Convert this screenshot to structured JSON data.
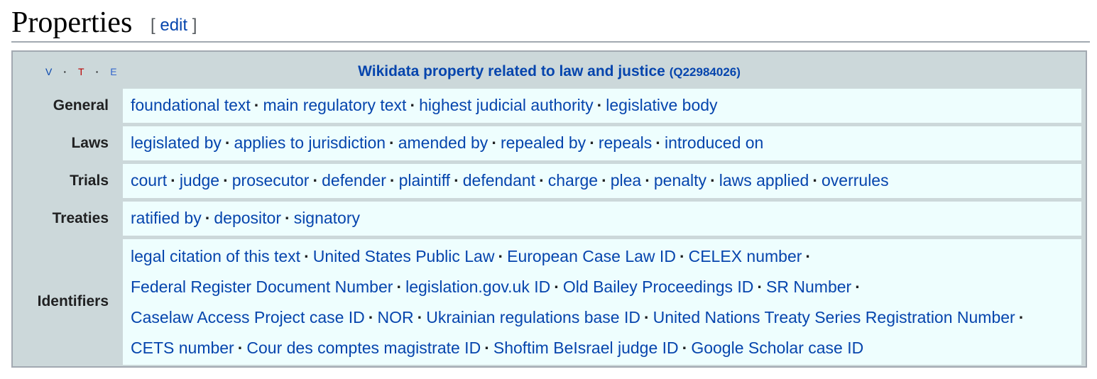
{
  "section": {
    "title": "Properties",
    "edit_open": "[ ",
    "edit_label": "edit",
    "edit_close": " ]"
  },
  "navbox": {
    "vte": {
      "v": "V",
      "t": "T",
      "e": "E",
      "sep": "·"
    },
    "title": "Wikidata property related to law and justice",
    "qid": "(Q22984026)",
    "separator": "·",
    "groups": {
      "general": {
        "label": "General",
        "items": [
          "foundational text",
          "main regulatory text",
          "highest judicial authority",
          "legislative body"
        ]
      },
      "laws": {
        "label": "Laws",
        "items": [
          "legislated by",
          "applies to jurisdiction",
          "amended by",
          "repealed by",
          "repeals",
          "introduced on"
        ]
      },
      "trials": {
        "label": "Trials",
        "items": [
          "court",
          "judge",
          "prosecutor",
          "defender",
          "plaintiff",
          "defendant",
          "charge",
          "plea",
          "penalty",
          "laws applied",
          "overrules"
        ]
      },
      "treaties": {
        "label": "Treaties",
        "items": [
          "ratified by",
          "depositor",
          "signatory"
        ]
      },
      "identifiers": {
        "label": "Identifiers",
        "items": [
          "legal citation of this text",
          "United States Public Law",
          "European Case Law ID",
          "CELEX number",
          "Federal Register Document Number",
          "legislation.gov.uk ID",
          "Old Bailey Proceedings ID",
          "SR Number",
          "Caselaw Access Project case ID",
          "NOR",
          "Ukrainian regulations base ID",
          "United Nations Treaty Series Registration Number",
          "CETS number",
          "Cour des comptes magistrate ID",
          "Shoftim BeIsrael judge ID",
          "Google Scholar case ID"
        ]
      }
    }
  }
}
